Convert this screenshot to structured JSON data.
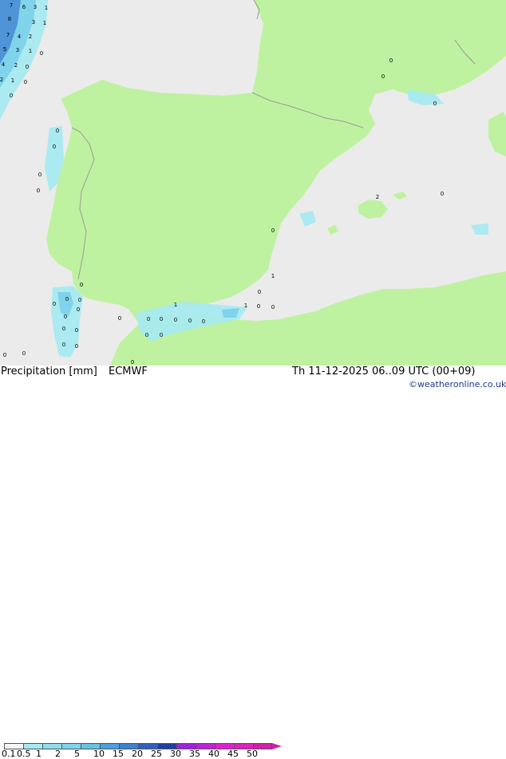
{
  "map": {
    "colors": {
      "sea": "#ebebeb",
      "land": "#bff2a0",
      "border": "#9a9a9a",
      "precip_light": "#a5eaf2",
      "precip_mid": "#7fd3ea",
      "precip_heavy": "#3f7fd0"
    },
    "value_labels": [
      {
        "text": "7"
      },
      {
        "text": "6"
      },
      {
        "text": "3"
      },
      {
        "text": "1"
      },
      {
        "text": "8"
      },
      {
        "text": "3"
      },
      {
        "text": "1"
      },
      {
        "text": "7"
      },
      {
        "text": "4"
      },
      {
        "text": "2"
      },
      {
        "text": "5"
      },
      {
        "text": "3"
      },
      {
        "text": "1"
      },
      {
        "text": "0"
      },
      {
        "text": "4"
      },
      {
        "text": "2"
      },
      {
        "text": "0"
      },
      {
        "text": "2"
      },
      {
        "text": "1"
      },
      {
        "text": "0"
      },
      {
        "text": "0"
      },
      {
        "text": "0"
      },
      {
        "text": "0"
      },
      {
        "text": "0"
      },
      {
        "text": "0"
      },
      {
        "text": "0"
      },
      {
        "text": "0"
      },
      {
        "text": "0"
      },
      {
        "text": "0"
      },
      {
        "text": "0"
      },
      {
        "text": "0"
      },
      {
        "text": "0"
      },
      {
        "text": "0"
      },
      {
        "text": "0"
      },
      {
        "text": "0"
      },
      {
        "text": "0"
      },
      {
        "text": "0"
      },
      {
        "text": "0"
      },
      {
        "text": "0"
      },
      {
        "text": "0"
      },
      {
        "text": "0"
      },
      {
        "text": "0"
      },
      {
        "text": "0"
      },
      {
        "text": "1"
      },
      {
        "text": "0"
      },
      {
        "text": "0"
      },
      {
        "text": "1"
      },
      {
        "text": "0"
      },
      {
        "text": "0"
      },
      {
        "text": "1"
      },
      {
        "text": "0"
      },
      {
        "text": "0"
      },
      {
        "text": "0"
      },
      {
        "text": "0"
      },
      {
        "text": "2"
      },
      {
        "text": "0"
      },
      {
        "text": "0"
      },
      {
        "text": "0"
      }
    ]
  },
  "legend": {
    "title": "Precipitation [mm]",
    "model": "ECMWF",
    "ticks": [
      "0.1",
      "0.5",
      "1",
      "2",
      "5",
      "10",
      "15",
      "20",
      "25",
      "30",
      "35",
      "40",
      "45",
      "50"
    ],
    "colors": [
      "#f5f5f5",
      "#a5eaf2",
      "#8fdcee",
      "#7fd3ea",
      "#66c2e6",
      "#4e9ee0",
      "#3f7fd0",
      "#2f5fc0",
      "#1f3fa0",
      "#a020e0",
      "#c020d8",
      "#e020d0",
      "#e020c0",
      "#d020a8"
    ]
  },
  "datetime": "Th 11-12-2025 06..09 UTC (00+09)",
  "credit": "©weatheronline.co.uk"
}
